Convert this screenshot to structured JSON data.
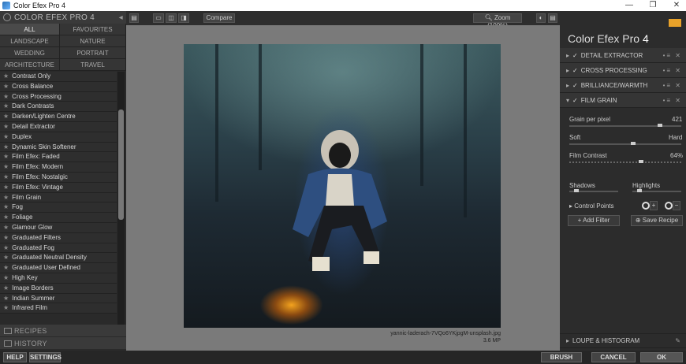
{
  "window": {
    "title": "Color Efex Pro 4",
    "controls": [
      "—",
      "❐",
      "✕"
    ]
  },
  "left": {
    "header": "COLOR EFEX PRO 4",
    "categories": [
      "ALL",
      "FAVOURITES",
      "LANDSCAPE",
      "NATURE",
      "WEDDING",
      "PORTRAIT",
      "ARCHITECTURE",
      "TRAVEL"
    ],
    "filters": [
      "Contrast Only",
      "Cross Balance",
      "Cross Processing",
      "Dark Contrasts",
      "Darken/Lighten Centre",
      "Detail Extractor",
      "Duplex",
      "Dynamic Skin Softener",
      "Film Efex: Faded",
      "Film Efex: Modern",
      "Film Efex: Nostalgic",
      "Film Efex: Vintage",
      "Film Grain",
      "Fog",
      "Foliage",
      "Glamour Glow",
      "Graduated Filters",
      "Graduated Fog",
      "Graduated Neutral Density",
      "Graduated User Defined",
      "High Key",
      "Image Borders",
      "Indian Summer",
      "Infrared Film"
    ],
    "recipes_label": "RECIPES",
    "history_label": "HISTORY"
  },
  "toolbar": {
    "compare_label": "Compare",
    "zoom_label": "Zoom (100%)"
  },
  "image": {
    "filename": "yannic-laderach-7VQo6YKjpgM-unsplash.jpg",
    "size": "3.6 MP"
  },
  "right": {
    "title": "Color Efex Pro",
    "title_num": "4",
    "filters": [
      "DETAIL EXTRACTOR",
      "CROSS PROCESSING",
      "BRILLIANCE/WARMTH",
      "FILM GRAIN"
    ],
    "grain_label": "Grain per pixel",
    "grain_value": "421",
    "soft_label": "Soft",
    "hard_label": "Hard",
    "contrast_label": "Film Contrast",
    "contrast_value": "64%",
    "shadows_label": "Shadows",
    "highlights_label": "Highlights",
    "control_points_label": "Control Points",
    "add_filter_label": "Add Filter",
    "save_recipe_label": "Save Recipe",
    "loupe_label": "LOUPE & HISTOGRAM"
  },
  "bottom": {
    "help": "HELP",
    "settings": "SETTINGS",
    "brush": "BRUSH",
    "cancel": "CANCEL",
    "ok": "OK"
  }
}
